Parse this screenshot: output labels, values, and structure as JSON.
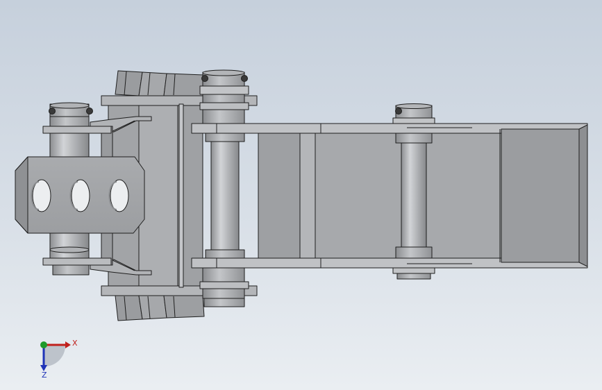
{
  "colors": {
    "background_top": "#c6d0dc",
    "background_bottom": "#eaeef2",
    "metal_light": "#b8babd",
    "metal_mid": "#a5a7aa",
    "metal_dark": "#8f9194",
    "edge": "#1e1e1e",
    "axis_x": "#c0201c",
    "axis_y": "#1e9a2a",
    "axis_z": "#2034b8"
  },
  "triad": {
    "x_label": "X",
    "z_label": "Z"
  },
  "icons": [
    "bolt-icon",
    "axis-triad-icon"
  ]
}
